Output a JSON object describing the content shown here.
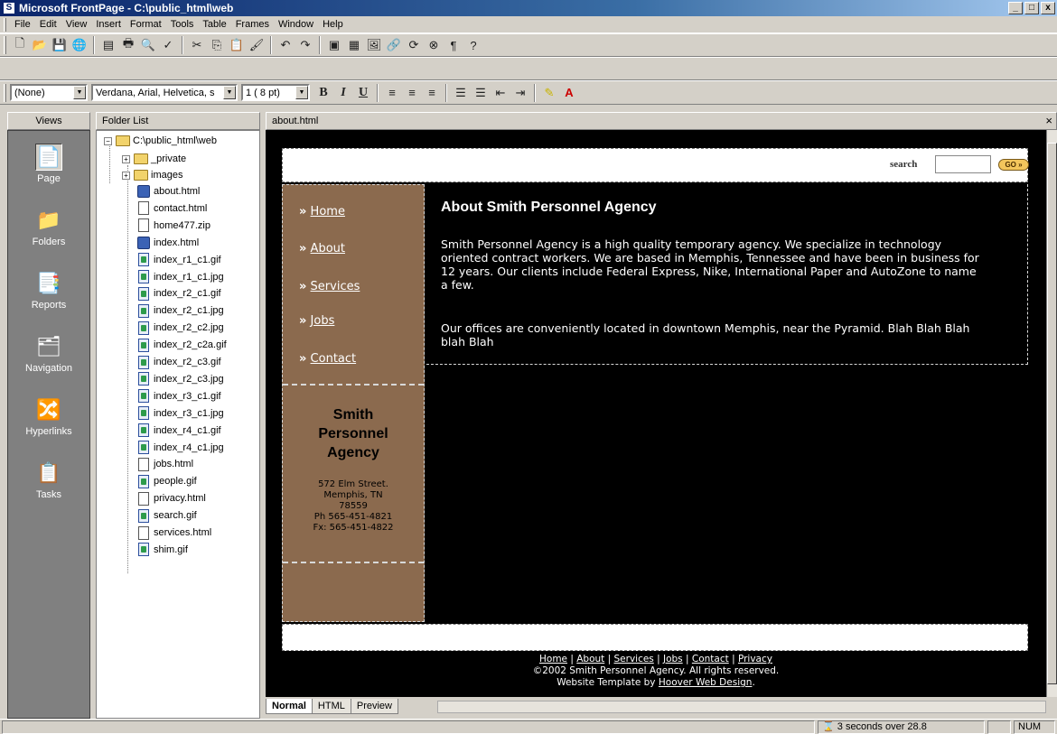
{
  "window": {
    "title": "Microsoft FrontPage - C:\\public_html\\web",
    "app_icon": "S",
    "min_glyph": "_",
    "max_glyph": "□",
    "close_glyph": "x"
  },
  "menu": [
    "File",
    "Edit",
    "View",
    "Insert",
    "Format",
    "Tools",
    "Table",
    "Frames",
    "Window",
    "Help"
  ],
  "formatting": {
    "style": "(None)",
    "font": "Verdana, Arial, Helvetica, s",
    "size": "1 ( 8 pt)"
  },
  "views": {
    "header": "Views",
    "items": [
      "Page",
      "Folders",
      "Reports",
      "Navigation",
      "Hyperlinks",
      "Tasks"
    ]
  },
  "folder_list": {
    "header": "Folder List",
    "root": "C:\\public_html\\web",
    "folders": [
      "_private",
      "images"
    ],
    "files": [
      {
        "name": "about.html",
        "type": "html"
      },
      {
        "name": "contact.html",
        "type": "page"
      },
      {
        "name": "home477.zip",
        "type": "page"
      },
      {
        "name": "index.html",
        "type": "html"
      },
      {
        "name": "index_r1_c1.gif",
        "type": "img"
      },
      {
        "name": "index_r1_c1.jpg",
        "type": "img"
      },
      {
        "name": "index_r2_c1.gif",
        "type": "img"
      },
      {
        "name": "index_r2_c1.jpg",
        "type": "img"
      },
      {
        "name": "index_r2_c2.jpg",
        "type": "img"
      },
      {
        "name": "index_r2_c2a.gif",
        "type": "img"
      },
      {
        "name": "index_r2_c3.gif",
        "type": "img"
      },
      {
        "name": "index_r2_c3.jpg",
        "type": "img"
      },
      {
        "name": "index_r3_c1.gif",
        "type": "img"
      },
      {
        "name": "index_r3_c1.jpg",
        "type": "img"
      },
      {
        "name": "index_r4_c1.gif",
        "type": "img"
      },
      {
        "name": "index_r4_c1.jpg",
        "type": "img"
      },
      {
        "name": "jobs.html",
        "type": "page"
      },
      {
        "name": "people.gif",
        "type": "img"
      },
      {
        "name": "privacy.html",
        "type": "page"
      },
      {
        "name": "search.gif",
        "type": "img"
      },
      {
        "name": "services.html",
        "type": "page"
      },
      {
        "name": "shim.gif",
        "type": "img"
      }
    ]
  },
  "editor": {
    "tab": "about.html",
    "close": "×"
  },
  "webpage": {
    "search_label": "search",
    "go_label": "GO »",
    "nav": [
      "Home",
      "About",
      "Services",
      "Jobs",
      "Contact"
    ],
    "nav_prefix": "»",
    "agency_name": [
      "Smith",
      "Personnel",
      "Agency"
    ],
    "address": [
      "572 Elm Street.",
      "Memphis, TN",
      "78559",
      "Ph 565-451-4821",
      "Fx: 565-451-4822"
    ],
    "title": "About Smith Personnel Agency",
    "para1": "Smith Personnel Agency is a high quality temporary agency. We specialize in technology oriented contract workers. We are based in Memphis, Tennessee and have been in business for 12 years. Our clients include Federal Express, Nike, International Paper and AutoZone to name a few.",
    "para2": "Our offices are conveniently located in downtown Memphis, near the Pyramid. Blah Blah Blah blah Blah",
    "footer_links": [
      "Home",
      "About",
      "Services",
      "Jobs",
      "Contact",
      "Privacy"
    ],
    "copyright": "©2002 Smith Personnel Agency. All rights reserved.",
    "template_prefix": "Website Template by ",
    "template_link": "Hoover Web Design",
    "template_suffix": "."
  },
  "modes": [
    "Normal",
    "HTML",
    "Preview"
  ],
  "status": {
    "download": "3 seconds over 28.8",
    "num": "NUM"
  }
}
